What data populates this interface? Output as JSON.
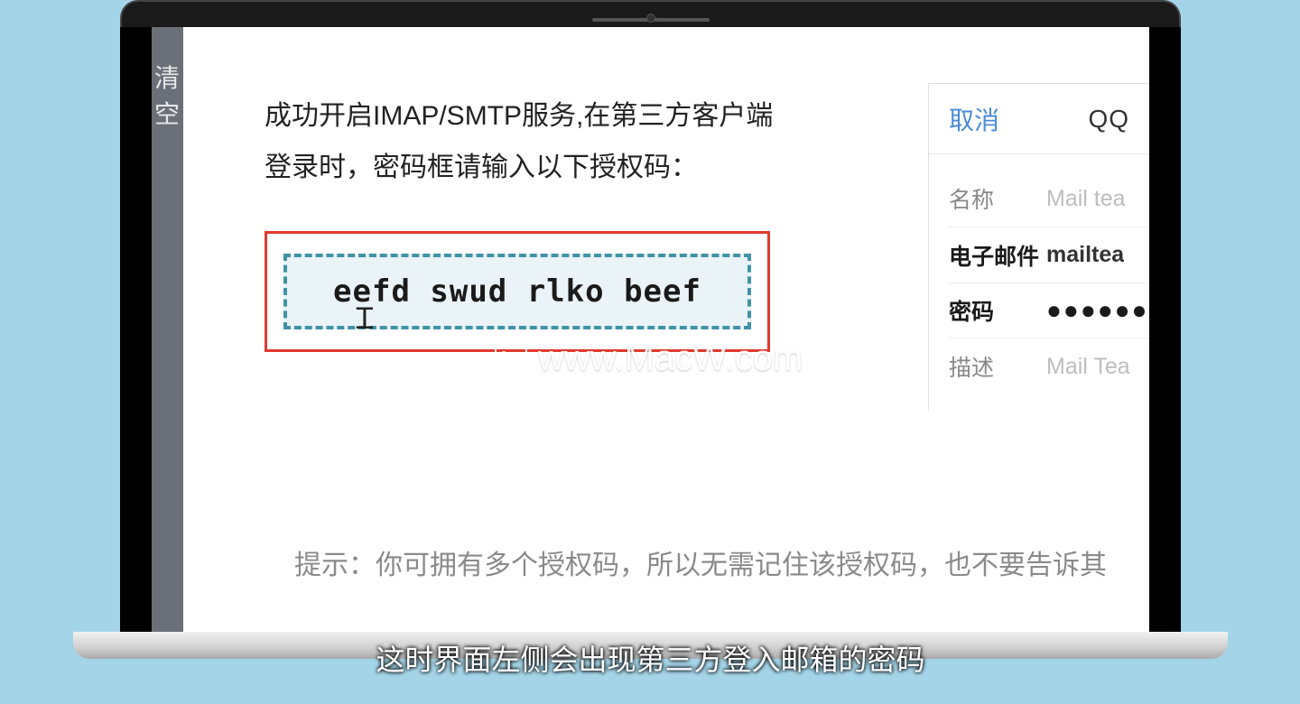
{
  "sidebar": {
    "frag": "清空"
  },
  "main": {
    "headline_l1": "成功开启IMAP/SMTP服务,在第三方客户端",
    "headline_l2": "登录时，密码框请输入以下授权码：",
    "auth_code": "eefd swud rlko beef",
    "hint": "提示：你可拥有多个授权码，所以无需记住该授权码，也不要告诉其"
  },
  "watermark": {
    "text": "www.MacW.com"
  },
  "panel": {
    "cancel": "取消",
    "brand": "QQ",
    "rows": {
      "name": {
        "label": "名称",
        "value": "Mail tea"
      },
      "email": {
        "label": "电子邮件",
        "value": "mailtea"
      },
      "password": {
        "label": "密码",
        "value": "●●●●●●"
      },
      "desc": {
        "label": "描述",
        "value": "Mail Tea"
      }
    }
  },
  "caption": "这时界面左侧会出现第三方登入邮箱的密码"
}
